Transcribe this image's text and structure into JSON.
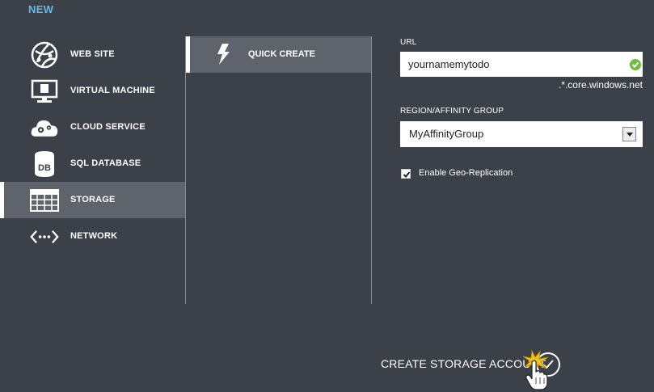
{
  "header": {
    "new_label": "NEW"
  },
  "nav": {
    "items": [
      {
        "label": "WEB SITE",
        "icon": "globe-icon",
        "selected": false
      },
      {
        "label": "VIRTUAL MACHINE",
        "icon": "monitor-icon",
        "selected": false
      },
      {
        "label": "CLOUD SERVICE",
        "icon": "cloud-gear-icon",
        "selected": false
      },
      {
        "label": "SQL DATABASE",
        "icon": "database-icon",
        "selected": false
      },
      {
        "label": "STORAGE",
        "icon": "storage-grid-icon",
        "selected": true
      },
      {
        "label": "NETWORK",
        "icon": "network-icon",
        "selected": false
      }
    ]
  },
  "options": {
    "quick_create_label": "QUICK CREATE",
    "icon": "lightning-icon"
  },
  "form": {
    "url_label": "URL",
    "url_value": "yournamemytodo",
    "url_suffix": ".*.core.windows.net",
    "region_label": "REGION/AFFINITY GROUP",
    "region_value": "MyAffinityGroup",
    "geo_label": "Enable Geo-Replication",
    "geo_checked": true
  },
  "footer": {
    "create_label": "CREATE STORAGE ACCOUNT"
  },
  "colors": {
    "background": "#3b4049",
    "selected": "#5f636b",
    "accent": "#6ab8e8",
    "valid": "#6fbe3d"
  }
}
